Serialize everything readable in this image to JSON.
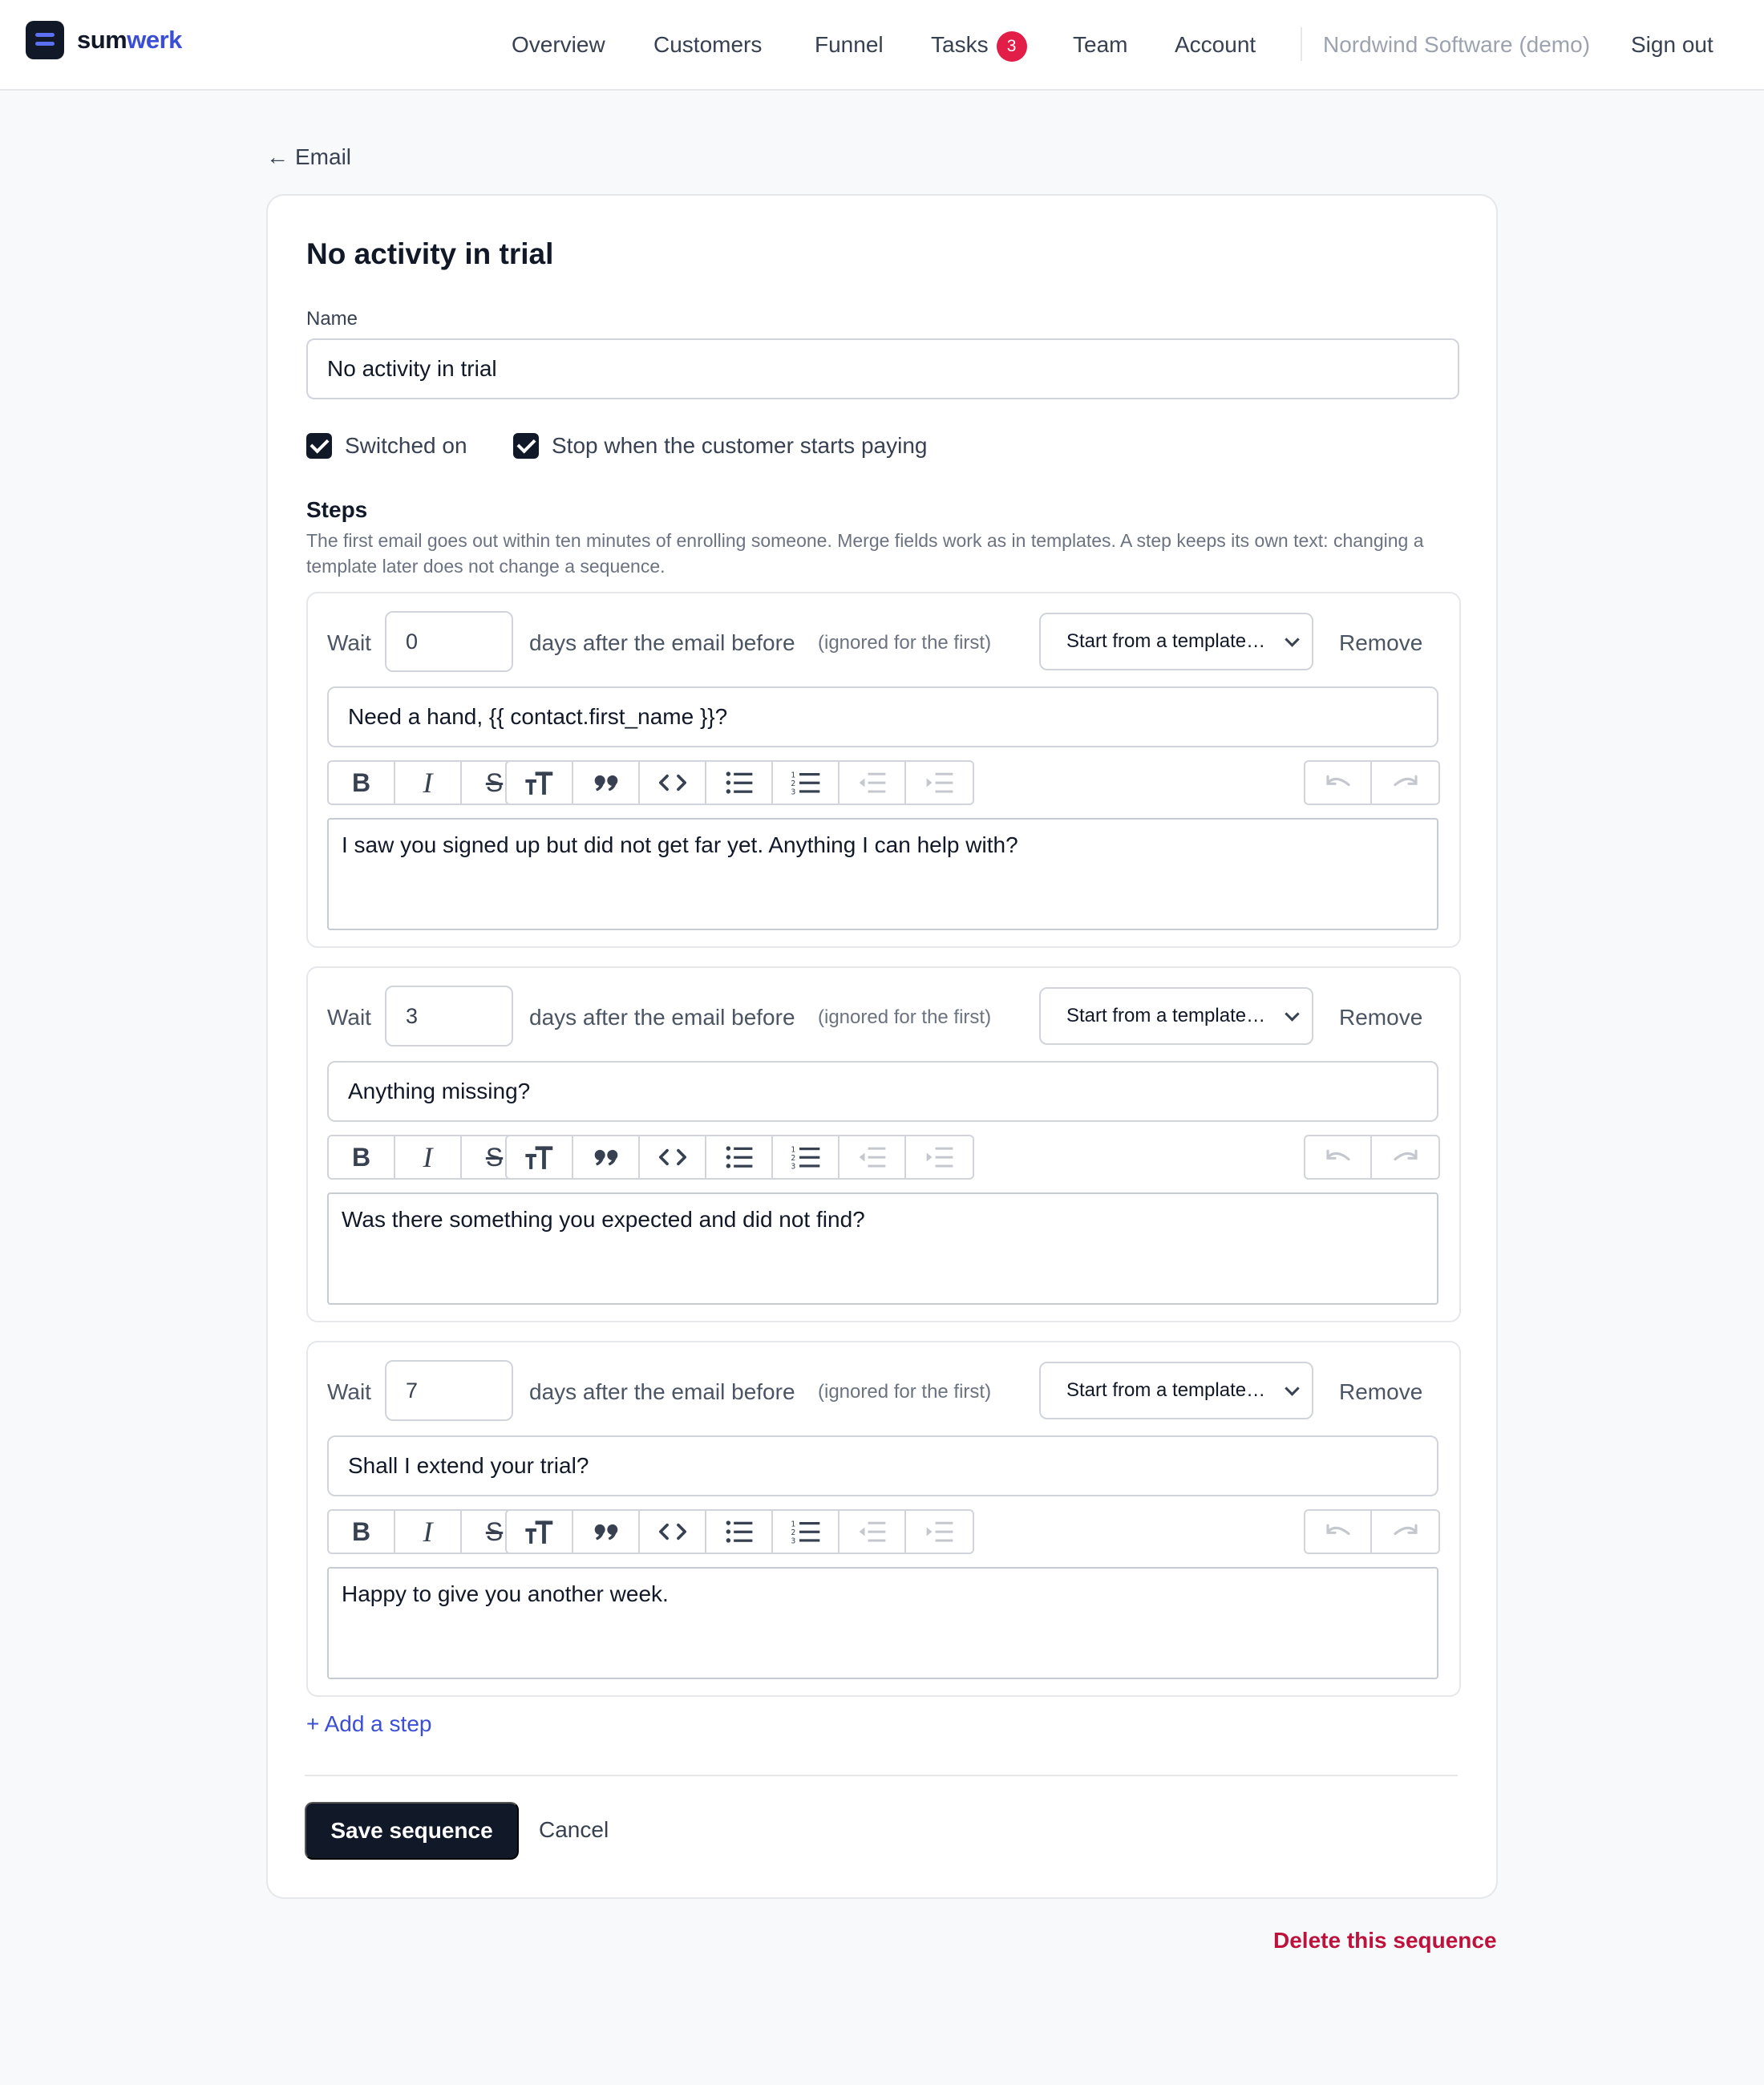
{
  "brand": {
    "name_a": "sum",
    "name_b": "werk"
  },
  "nav": {
    "overview": "Overview",
    "customers": "Customers",
    "funnel": "Funnel",
    "tasks": "Tasks",
    "tasks_badge": "3",
    "team": "Team",
    "account": "Account",
    "org": "Nordwind Software (demo)",
    "sign_out": "Sign out"
  },
  "back": {
    "arrow": "←",
    "label": "Email"
  },
  "form": {
    "title": "No activity in trial",
    "name_label": "Name",
    "name_value": "No activity in trial",
    "switched_on_label": "Switched on",
    "switched_on": true,
    "stop_paying_label": "Stop when the customer starts paying",
    "stop_paying": true,
    "steps_title": "Steps",
    "steps_help": "The first email goes out within ten minutes of enrolling someone. Merge fields work as in templates. A step keeps its own text: changing a template later does not change a sequence."
  },
  "step_labels": {
    "wait": "Wait",
    "days_after": "days after the email before",
    "ignored": "(ignored for the first)",
    "template_select": "Start from a template…",
    "remove": "Remove"
  },
  "steps": [
    {
      "wait_days": "0",
      "subject": "Need a hand, {{ contact.first_name }}?",
      "body": "I saw you signed up but did not get far yet. Anything I can help with?"
    },
    {
      "wait_days": "3",
      "subject": "Anything missing?",
      "body": "Was there something you expected and did not find?"
    },
    {
      "wait_days": "7",
      "subject": "Shall I extend your trial?",
      "body": "Happy to give you another week."
    }
  ],
  "actions": {
    "add_step": "+ Add a step",
    "save": "Save sequence",
    "cancel": "Cancel",
    "delete": "Delete this sequence"
  }
}
